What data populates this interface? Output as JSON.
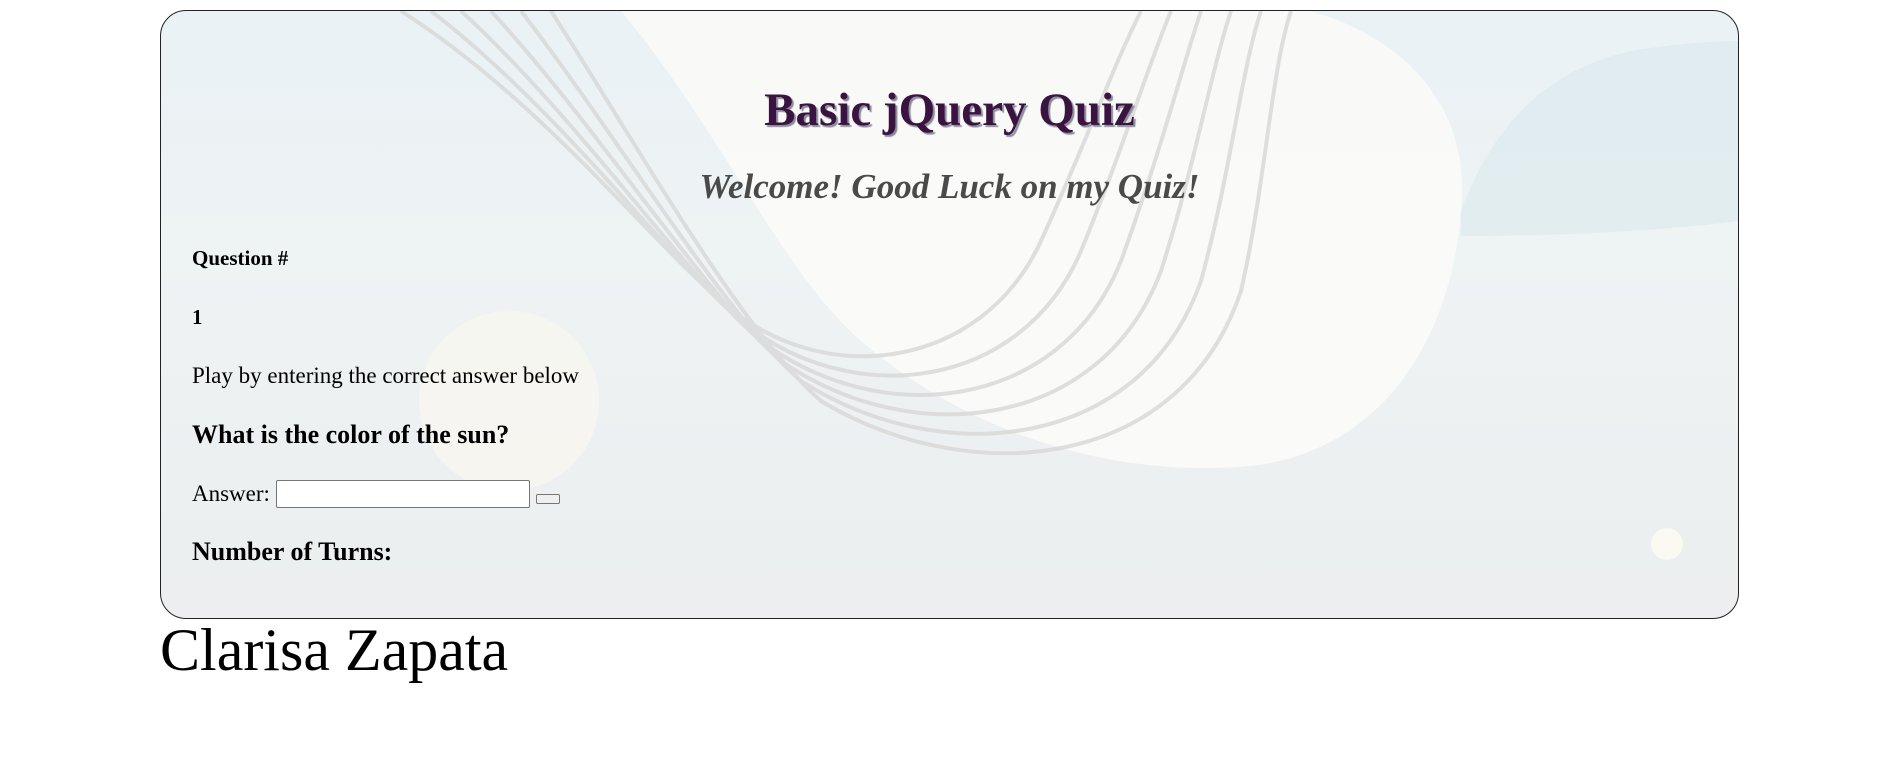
{
  "quiz": {
    "title": "Basic jQuery Quiz",
    "welcome": "Welcome! Good Luck on my Quiz!",
    "question_label": "Question #",
    "question_number": "1",
    "instructions": "Play by entering the correct answer below",
    "question_text": "What is the color of the sun?",
    "answer_label": "Answer:",
    "answer_value": "",
    "submit_label": "",
    "turns_label": "Number of Turns:"
  },
  "footer": {
    "author": "Clarisa Zapata"
  },
  "colors": {
    "title": "#3a1340",
    "welcome": "#4a4a4a",
    "card_border": "#222222"
  }
}
